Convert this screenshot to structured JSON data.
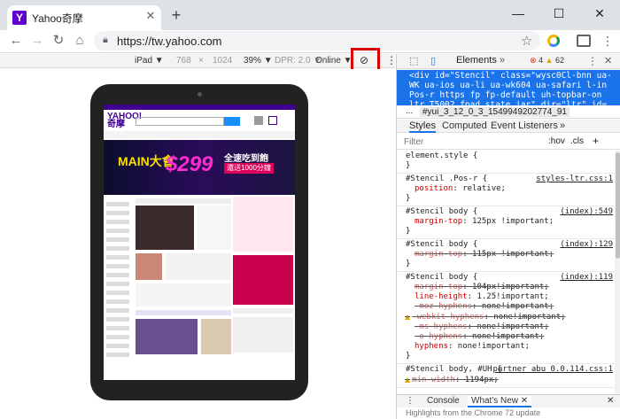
{
  "browser": {
    "tab_title": "Yahoo奇摩",
    "tab_favicon": "Y",
    "url": "https://tw.yahoo.com",
    "window_controls": [
      "—",
      "☐",
      "✕"
    ]
  },
  "device_toolbar": {
    "device": "iPad ▼",
    "width": "768",
    "times": "×",
    "height": "1024",
    "zoom": "39% ▼",
    "dpr": "DPR: 2.0 ▼",
    "network": "Online ▼"
  },
  "yahoo_page": {
    "logo_line1": "YAHOO!",
    "logo_line2": "奇摩",
    "banner_a": "MAIN大會",
    "banner_b": "$299",
    "banner_c": "全速吃到飽",
    "banner_d": "還送1000分鐘"
  },
  "devtools": {
    "elements_tab": "Elements",
    "more_tabs": "»",
    "errors": "4",
    "warnings": "62",
    "dom_text": "<div id=\"Stencil\" class=\"wysc0Cl-bnn ua-WK ua-ios ua-li ua-wk604 ua-safari l-in Pos-r https fp fp-default uh-topbar-on ltr T5002 fpad_state jar\" dir=\"ltr\" id=",
    "breadcrumb_ellipsis": "...",
    "breadcrumb": "#yui_3_12_0_3_1549949202774_91",
    "tabs": [
      "Styles",
      "Computed",
      "Event Listeners",
      "»"
    ],
    "filter_placeholder": "Filter",
    "filter_hov": ":hov",
    "filter_cls": ".cls",
    "filter_plus": "+",
    "rules": [
      {
        "selector": "element.style {",
        "source": "",
        "decls": [],
        "close": "}"
      },
      {
        "selector": "#Stencil .Pos-r {",
        "source": "styles-ltr.css:1",
        "decls": [
          {
            "prop": "position",
            "val": ": relative;",
            "struck": false,
            "warn": false
          }
        ],
        "close": "}"
      },
      {
        "selector": "#Stencil body {",
        "source": "(index):549",
        "decls": [
          {
            "prop": "margin-top",
            "val": ": 125px !important;",
            "struck": false,
            "warn": false
          }
        ],
        "close": "}"
      },
      {
        "selector": "#Stencil body {",
        "source": "(index):129",
        "decls": [
          {
            "prop": "margin-top",
            "val": ": 115px !important;",
            "struck": true,
            "warn": false
          }
        ],
        "close": "}"
      },
      {
        "selector": "#Stencil body {",
        "source": "(index):119",
        "decls": [
          {
            "prop": "margin-top",
            "val": ": 104px!important;",
            "struck": true,
            "warn": false
          },
          {
            "prop": "line-height",
            "val": ": 1.25!important;",
            "struck": false,
            "warn": false
          },
          {
            "prop": "-moz-hyphens",
            "val": ": none!important;",
            "struck": true,
            "warn": false
          },
          {
            "prop": "-webkit-hyphens",
            "val": ": none!important;",
            "struck": true,
            "warn": true
          },
          {
            "prop": "-ms-hyphens",
            "val": ": none!important;",
            "struck": true,
            "warn": false
          },
          {
            "prop": "-o-hyphens",
            "val": ": none!important;",
            "struck": true,
            "warn": false
          },
          {
            "prop": "hyphens",
            "val": ": none!important;",
            "struck": false,
            "warn": false
          }
        ],
        "close": "}"
      },
      {
        "selector": "#Stencil body, #UH {",
        "source": "partner_abu_0.0.114.css:1",
        "decls": [
          {
            "prop": "min-width",
            "val": ": 1194px;",
            "struck": true,
            "warn": true
          }
        ],
        "close": ""
      }
    ],
    "drawer_tabs": [
      "Console",
      "What's New ✕"
    ],
    "drawer_text": "Highlights from the Chrome 72 update"
  }
}
